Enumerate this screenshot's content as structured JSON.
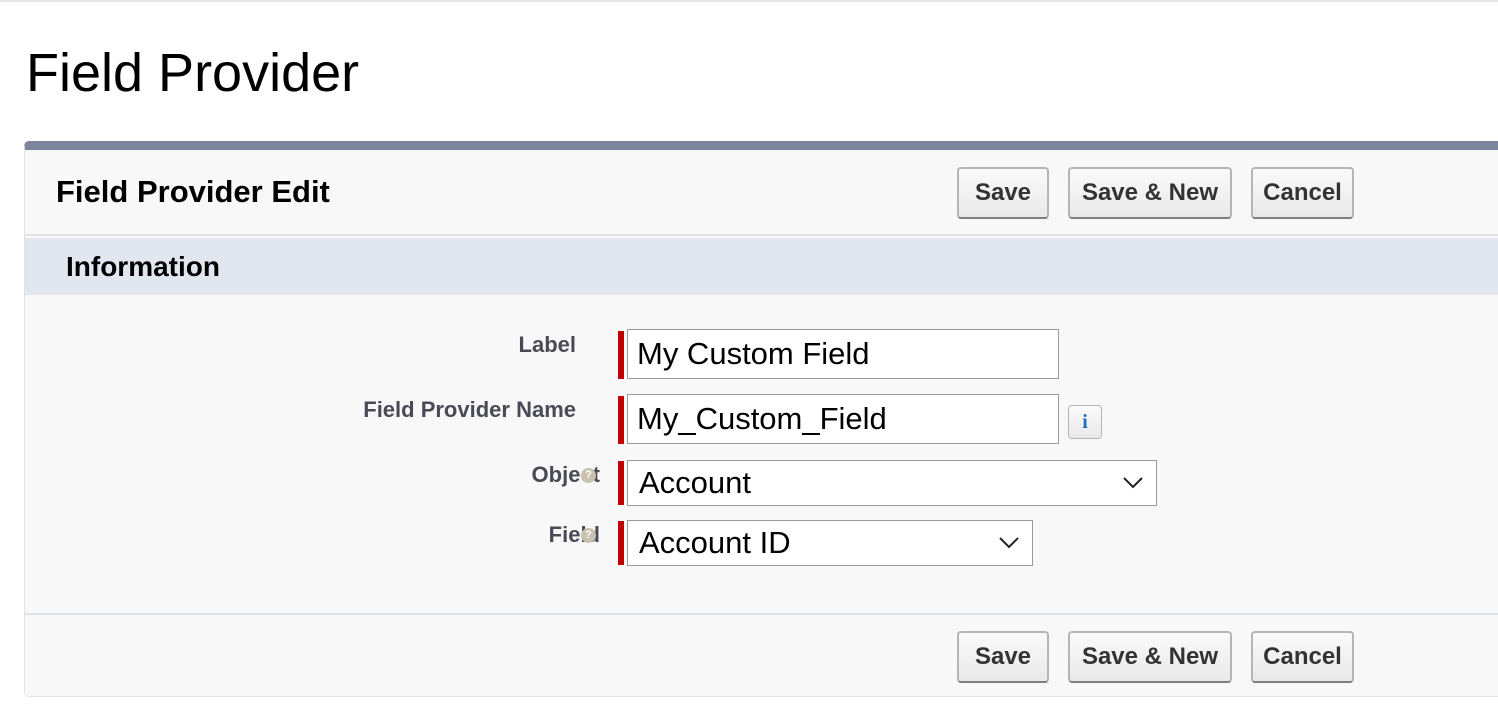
{
  "page": {
    "title": "Field Provider"
  },
  "panel": {
    "title": "Field Provider Edit",
    "buttons": {
      "save": "Save",
      "save_new": "Save & New",
      "cancel": "Cancel"
    },
    "section": {
      "title": "Information"
    },
    "fields": {
      "label": {
        "label": "Label",
        "value": "My Custom Field"
      },
      "name": {
        "label": "Field Provider Name",
        "value": "My_Custom_Field",
        "info_icon": "i"
      },
      "object": {
        "label": "Object",
        "value": "Account",
        "help_icon": "?"
      },
      "field": {
        "label": "Field",
        "value": "Account ID",
        "help_icon": "?"
      }
    }
  },
  "colors": {
    "required_marker": "#c00000",
    "panel_top_border": "#7c879d",
    "section_bar": "#e2e6ef"
  }
}
